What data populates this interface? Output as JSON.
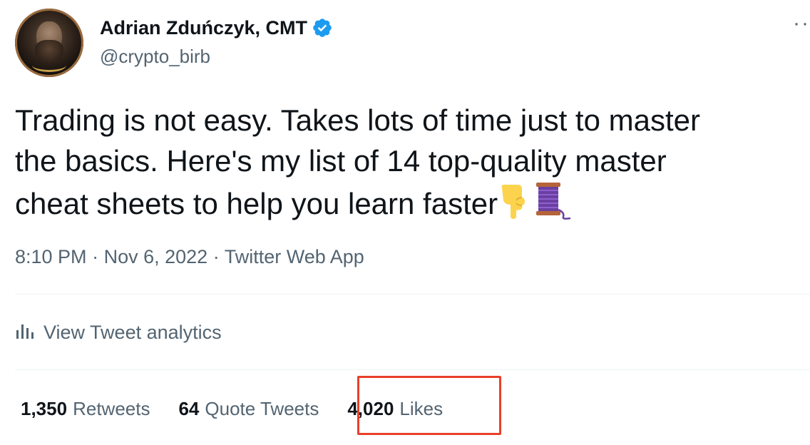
{
  "author": {
    "display_name": "Adrian Zduńczyk, CMT",
    "handle": "@crypto_birb",
    "verified": true,
    "avatar_icon": "avatar-photo"
  },
  "tweet": {
    "text": "Trading is not easy. Takes lots of time just to master\nthe basics. Here's my list of 14 top-quality master\ncheat sheets to help you learn faster",
    "emojis": [
      "backhand-index-pointing-down-icon",
      "thread-spool-icon"
    ]
  },
  "meta": {
    "time": "8:10 PM",
    "date": "Nov 6, 2022",
    "source": "Twitter Web App",
    "separator": "·"
  },
  "analytics": {
    "label": "View Tweet analytics",
    "icon": "analytics-bars-icon"
  },
  "stats": {
    "retweets": {
      "count": "1,350",
      "label": "Retweets"
    },
    "quotes": {
      "count": "64",
      "label": "Quote Tweets"
    },
    "likes": {
      "count": "4,020",
      "label": "Likes"
    }
  },
  "colors": {
    "verified": "#1d9bf0",
    "highlight_box": "#e8402a",
    "text_primary": "#0f1419",
    "text_secondary": "#536471"
  }
}
